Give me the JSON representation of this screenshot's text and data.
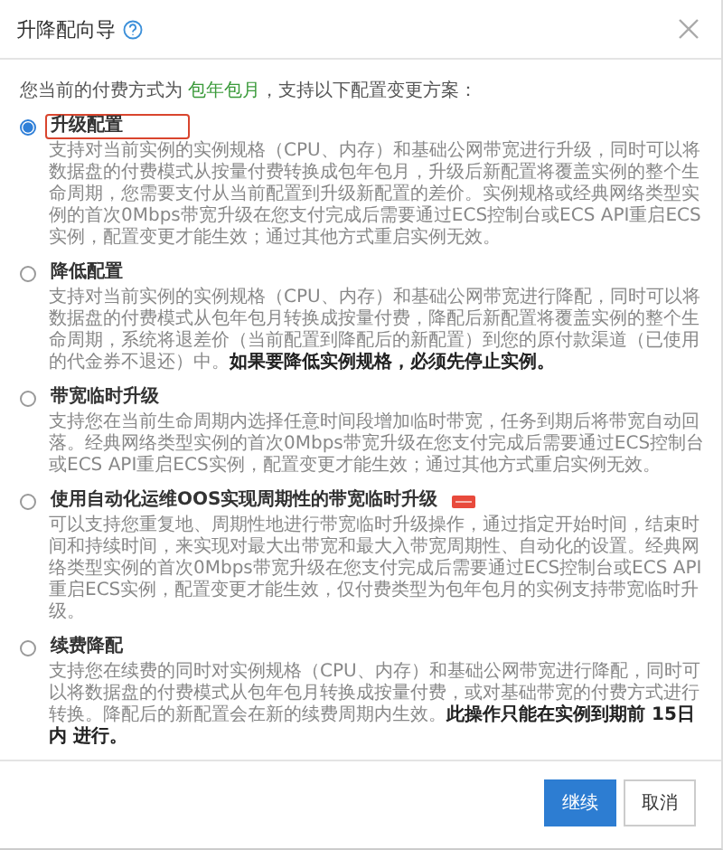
{
  "dialog": {
    "title": "升降配向导",
    "intro": "您当前的付费方式为 ",
    "billing": "包年包月",
    "intro_tail": "，支持以下配置变更方案：",
    "options": [
      {
        "title": "升级配置",
        "selected": true,
        "highlighted": true,
        "badge": false,
        "description": "支持对当前实例的实例规格（CPU、内存）和基础公网带宽进行升级，同时可以将数据盘的付费模式从按量付费转换成包年包月，升级后新配置将覆盖实例的整个生命周期，您需要支付从当前配置到升级新配置的差价。实例规格或经典网络类型实例的首次0Mbps带宽升级在您支付完成后需要通过ECS控制台或ECS API重启ECS实例，配置变更才能生效；通过其他方式重启实例无效。"
      },
      {
        "title": "降低配置",
        "selected": false,
        "highlighted": false,
        "badge": false,
        "description": "支持对当前实例的实例规格（CPU、内存）和基础公网带宽进行降配，同时可以将数据盘的付费模式从包年包月转换成按量付费，降配后新配置将覆盖实例的整个生命周期，系统将退差价（当前配置到降配后的新配置）到您的原付款渠道（已使用的代金券不退还）中。**如果要降低实例规格，必须先停止实例。**"
      },
      {
        "title": "带宽临时升级",
        "selected": false,
        "highlighted": false,
        "badge": false,
        "description": "支持您在当前生命周期内选择任意时间段增加临时带宽，任务到期后将带宽自动回落。经典网络类型实例的首次0Mbps带宽升级在您支付完成后需要通过ECS控制台或ECS API重启ECS实例，配置变更才能生效；通过其他方式重启实例无效。"
      },
      {
        "title": "使用自动化运维OOS实现周期性的带宽临时升级",
        "selected": false,
        "highlighted": false,
        "badge": true,
        "description": "可以支持您重复地、周期性地进行带宽临时升级操作，通过指定开始时间，结束时间和持续时间，来实现对最大出带宽和最大入带宽周期性、自动化的设置。经典网络类型实例的首次0Mbps带宽升级在您支付完成后需要通过ECS控制台或ECS API重启ECS实例，配置变更才能生效，仅付费类型为包年包月的实例支持带宽临时升级。"
      },
      {
        "title": "续费降配",
        "selected": false,
        "highlighted": false,
        "badge": false,
        "description": "支持您在续费的同时对实例规格（CPU、内存）和基础公网带宽进行降配，同时可以将数据盘的付费模式从包年包月转换成按量付费，或对基础带宽的付费方式进行转换。降配后的新配置会在新的续费周期内生效。**此操作只能在实例到期前 15日内 进行。**"
      }
    ],
    "buttons": [
      {
        "label": "继续",
        "kind": "primary"
      },
      {
        "label": "取消",
        "kind": "secondary"
      }
    ]
  }
}
